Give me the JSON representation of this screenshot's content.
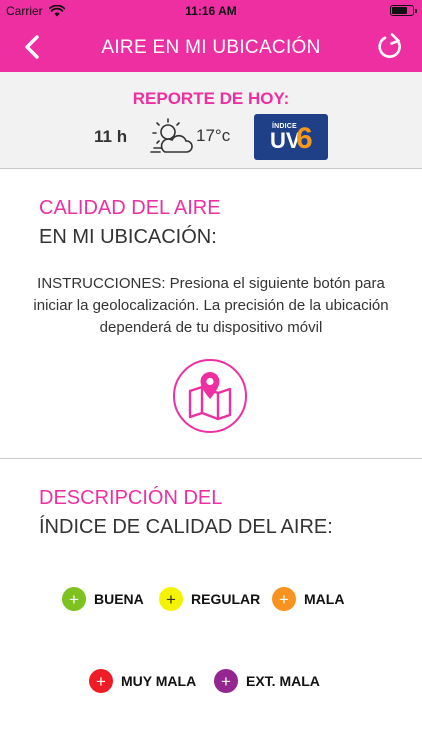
{
  "status": {
    "carrier": "Carrier",
    "time": "11:16 AM",
    "battery_level": 0.8
  },
  "nav": {
    "title": "AIRE EN MI UBICACIÓN",
    "back_icon": "chevron-left-icon",
    "refresh_icon": "refresh-icon"
  },
  "report": {
    "title": "REPORTE DE HOY:",
    "hour": "11 h",
    "weather_icon": "partly-cloudy-icon",
    "temperature": "17°c",
    "uv_label": "ÍNDICE",
    "uv_text": "UV",
    "uv_value": "6"
  },
  "air_quality": {
    "title_line1": "CALIDAD DEL AIRE",
    "title_line2": "EN MI UBICACIÓN:",
    "instructions": "INSTRUCCIONES: Presiona el siguiente botón para iniciar la geolocalización. La precisión de la ubicación dependerá de tu dispositivo móvil",
    "geo_icon": "map-pin-icon"
  },
  "description": {
    "title_line1": "DESCRIPCIÓN DEL",
    "title_line2": "ÍNDICE DE CALIDAD DEL AIRE:",
    "legend": [
      {
        "label": "BUENA",
        "color": "#7dc21e",
        "symbol": "+",
        "symbol_color": "#ffffff"
      },
      {
        "label": "REGULAR",
        "color": "#f4f400",
        "symbol": "+",
        "symbol_color": "#333333"
      },
      {
        "label": "MALA",
        "color": "#f7931e",
        "symbol": "+",
        "symbol_color": "#ffffff"
      },
      {
        "label": "MUY MALA",
        "color": "#ee1c24",
        "symbol": "+",
        "symbol_color": "#ffffff"
      },
      {
        "label": "EXT. MALA",
        "color": "#93278f",
        "symbol": "+",
        "symbol_color": "#ffffff"
      }
    ]
  },
  "colors": {
    "accent": "#ee2fa1",
    "uv_badge": "#1f3f87",
    "uv_number": "#f39a1d"
  }
}
